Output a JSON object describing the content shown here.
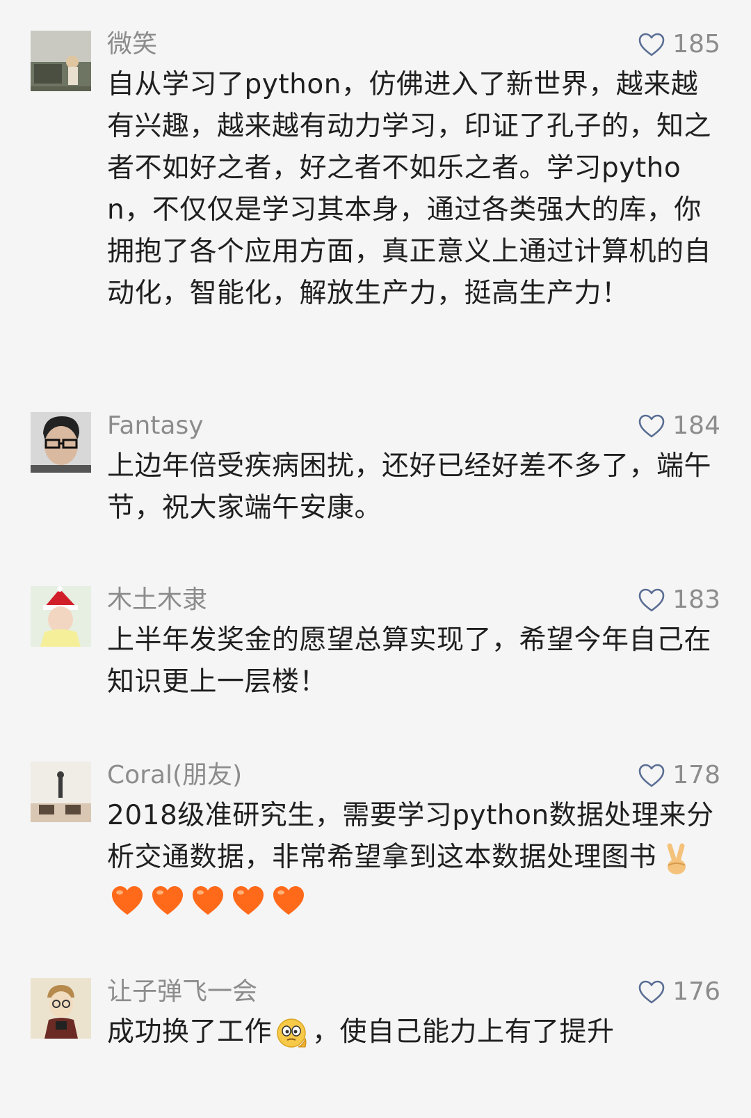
{
  "colors": {
    "background": "#f5f5f5",
    "meta_text": "#8c8c8c",
    "body_text": "#1f1f1f",
    "heart_outline": "#5a6e94",
    "emoji_heart": "#ff6a1a"
  },
  "comments": [
    {
      "user": "微笑",
      "likes": "185",
      "text": "自从学习了python，仿佛进入了新世界，越来越有兴趣，越来越有动力学习，印证了孔子的，知之者不如好之者，好之者不如乐之者。学习python，不仅仅是学习其本身，通过各类强大的库，你拥抱了各个应用方面，真正意义上通过计算机的自动化，智能化，解放生产力，挺高生产力！",
      "icon": "heart-outline-icon"
    },
    {
      "user": "Fantasy",
      "likes": "184",
      "text": "上边年倍受疾病困扰，还好已经好差不多了，端午节，祝大家端午安康。",
      "icon": "heart-outline-icon"
    },
    {
      "user": "木土木隶",
      "likes": "183",
      "text": "上半年发奖金的愿望总算实现了，希望今年自己在知识更上一层楼！",
      "icon": "heart-outline-icon"
    },
    {
      "user": "Coral(朋友)",
      "likes": "178",
      "text": "2018级准研究生，需要学习python数据处理来分析交通数据，非常希望拿到这本数据处理图书",
      "emojis": [
        "victory-hand-emoji",
        "orange-heart-emoji",
        "orange-heart-emoji",
        "orange-heart-emoji",
        "orange-heart-emoji",
        "orange-heart-emoji"
      ],
      "icon": "heart-outline-icon"
    },
    {
      "user": "让子弹飞一会",
      "likes": "176",
      "text_before_emoji": "成功换了工作",
      "text_after_emoji": "，使自己能力上有了提升",
      "emojis": [
        "thinking-face-emoji"
      ],
      "icon": "heart-outline-icon"
    }
  ]
}
